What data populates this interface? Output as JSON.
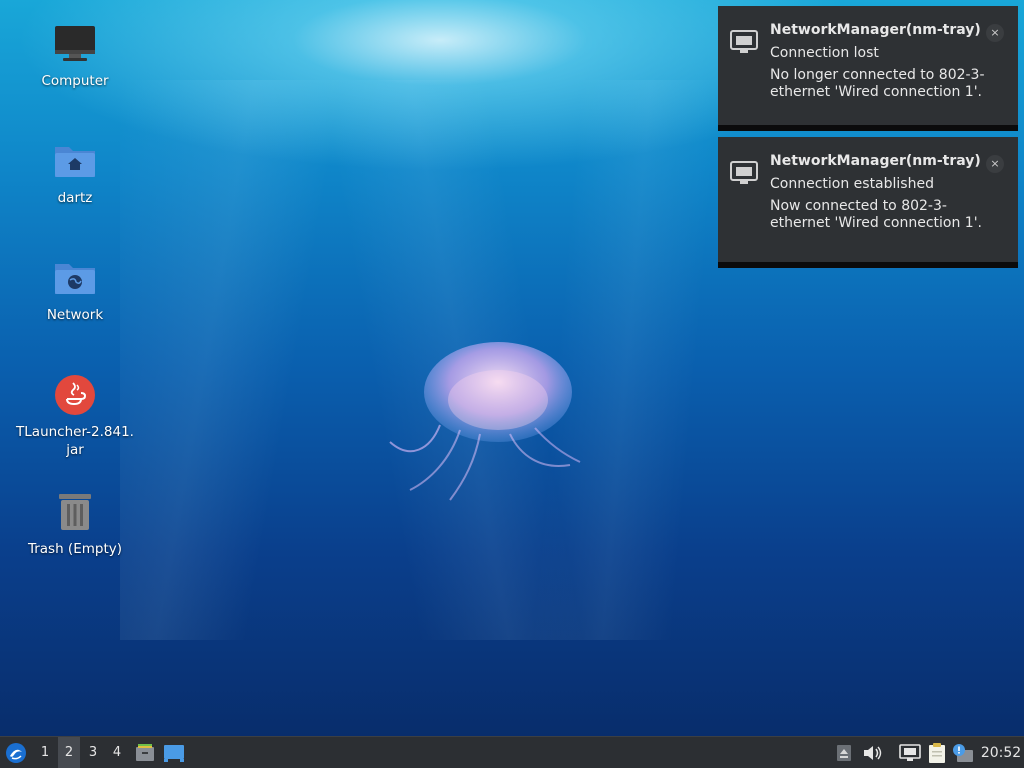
{
  "desktop": {
    "icons": [
      {
        "label": "Computer",
        "icon": "computer-icon"
      },
      {
        "label": "dartz",
        "icon": "home-folder-icon"
      },
      {
        "label": "Network",
        "icon": "network-folder-icon"
      },
      {
        "label": "TLauncher-2.841.jar",
        "icon": "java-icon"
      },
      {
        "label": "Trash (Empty)",
        "icon": "trash-icon"
      }
    ]
  },
  "notifications": [
    {
      "app": "NetworkManager(nm-tray)",
      "summary": "Connection lost",
      "body": "No longer connected to 802-3-ethernet 'Wired connection 1'.",
      "close": "×",
      "icon": "network-wired-icon"
    },
    {
      "app": "NetworkManager(nm-tray)",
      "summary": "Connection established",
      "body": "Now connected to 802-3-ethernet 'Wired connection 1'.",
      "close": "×",
      "icon": "network-wired-icon"
    }
  ],
  "taskbar": {
    "start_icon": "lubuntu-menu-icon",
    "workspaces": [
      "1",
      "2",
      "3",
      "4"
    ],
    "active_workspace": "2",
    "quicklaunch": [
      "file-manager-icon",
      "show-desktop-icon"
    ],
    "tray": [
      "tray-arrow-icon",
      "volume-icon",
      "network-wired-icon",
      "clipboard-icon",
      "update-notifier-icon"
    ],
    "clock": "20:52"
  },
  "colors": {
    "notification_bg": "#2e3134",
    "taskbar_bg": "#2c2f33",
    "folder_blue": "#5294e2",
    "java_red": "#e2483d"
  }
}
